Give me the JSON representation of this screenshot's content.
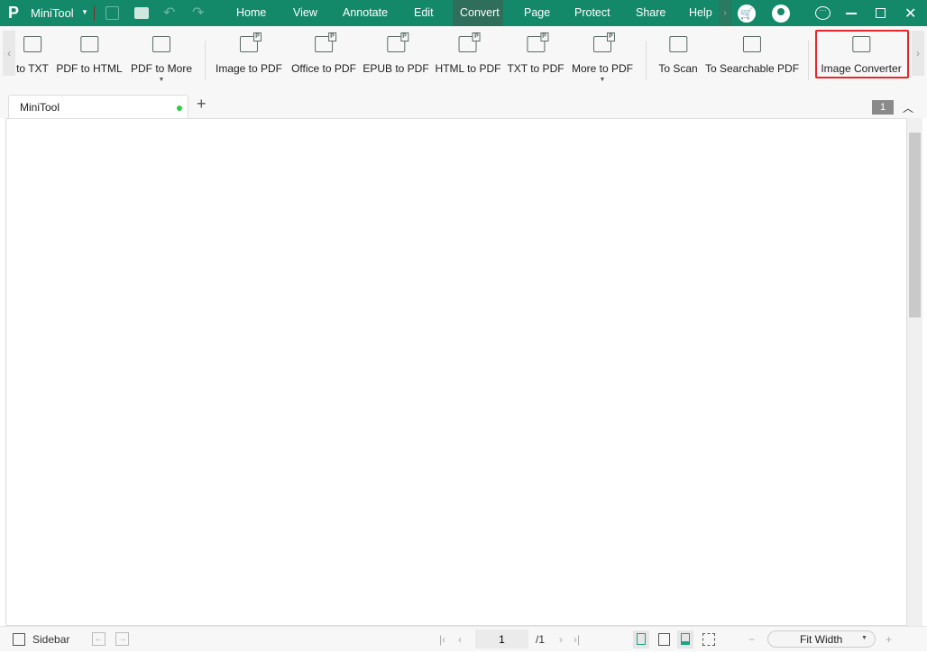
{
  "app": {
    "title": "MiniTool",
    "logo_text": "P"
  },
  "menu": [
    {
      "label": "Home"
    },
    {
      "label": "View"
    },
    {
      "label": "Annotate"
    },
    {
      "label": "Edit"
    },
    {
      "label": "Convert",
      "active": true
    },
    {
      "label": "Page"
    },
    {
      "label": "Protect"
    },
    {
      "label": "Share"
    },
    {
      "label": "Help"
    }
  ],
  "ribbon": {
    "items": [
      {
        "label": "to TXT",
        "glyph": "T"
      },
      {
        "label": "PDF to HTML",
        "glyph": "</>"
      },
      {
        "label": "PDF to More",
        "glyph": "...",
        "dropdown": true
      },
      {
        "label": "Image to PDF",
        "glyph": "P"
      },
      {
        "label": "Office to PDF",
        "glyph": "P"
      },
      {
        "label": "EPUB to PDF",
        "glyph": "P"
      },
      {
        "label": "HTML to PDF",
        "glyph": "P"
      },
      {
        "label": "TXT to PDF",
        "glyph": "P"
      },
      {
        "label": "More to PDF",
        "glyph": "P",
        "dropdown": true
      },
      {
        "label": "To Scan",
        "glyph": "⇄"
      },
      {
        "label": "To Searchable PDF",
        "glyph": "A"
      },
      {
        "label": "Image Converter",
        "glyph": "↺",
        "highlighted": true
      }
    ]
  },
  "tabs": [
    {
      "label": "MiniTool",
      "status_color": "#2ecc40"
    }
  ],
  "page_badge": "1",
  "status": {
    "sidebar_label": "Sidebar",
    "page_input": "1",
    "page_total": "/1",
    "zoom": "Fit Width"
  },
  "colors": {
    "brand": "#14896a",
    "highlight": "#e8262b",
    "accent": "#1aa385"
  }
}
